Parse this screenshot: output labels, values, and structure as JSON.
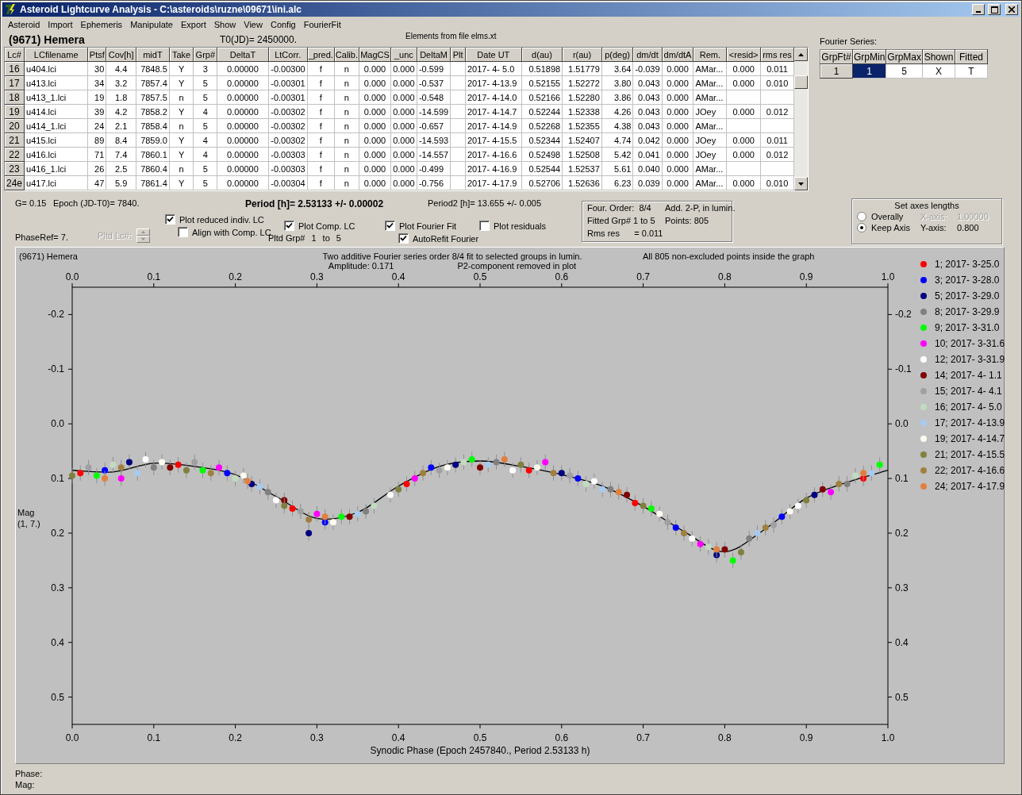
{
  "window": {
    "title": "Asteroid Lightcurve Analysis - C:\\asteroids\\ruzne\\09671\\ini.alc"
  },
  "menu": [
    "Asteroid",
    "Import",
    "Ephemeris",
    "Manipulate",
    "Export",
    "Show",
    "View",
    "Config",
    "FourierFit"
  ],
  "header": {
    "asteroid": "(9671) Hemera",
    "t0": "T0(JD)= 2450000.",
    "elements": "Elements from file elms.xt"
  },
  "table": {
    "columns": [
      "Lc#",
      "LCfilename",
      "Ptsf",
      "Cov[h]",
      "midT",
      "Take",
      "Grp#",
      "DeltaT",
      "LtCorr.",
      "_pred.",
      "Calib.",
      "MagCS",
      "_unc",
      "DeltaM",
      "Plt",
      "Date UT",
      "d(au)",
      "r(au)",
      "p(deg)",
      "dm/dt",
      "dm/dtA",
      "Rem.",
      "<resid>",
      "rms res"
    ],
    "rows": [
      [
        "16",
        "u404.lci",
        "30",
        "4.4",
        "7848.5",
        "Y",
        "3",
        "0.00000",
        "-0.00300",
        "f",
        "n",
        "0.000",
        "0.000",
        "-0.599",
        null,
        "2017- 4- 5.0",
        "0.51898",
        "1.51779",
        "3.64",
        "-0.039",
        "0.000",
        "AMar...",
        "0.000",
        "0.011"
      ],
      [
        "17",
        "u413.lci",
        "34",
        "3.2",
        "7857.4",
        "Y",
        "5",
        "0.00000",
        "-0.00301",
        "f",
        "n",
        "0.000",
        "0.000",
        "-0.537",
        null,
        "2017- 4-13.9",
        "0.52155",
        "1.52272",
        "3.80",
        "0.043",
        "0.000",
        "AMar...",
        "0.000",
        "0.010"
      ],
      [
        "18",
        "u413_1.lci",
        "19",
        "1.8",
        "7857.5",
        "n",
        "5",
        "0.00000",
        "-0.00301",
        "f",
        "n",
        "0.000",
        "0.000",
        "-0.548",
        null,
        "2017- 4-14.0",
        "0.52166",
        "1.52280",
        "3.86",
        "0.043",
        "0.000",
        "AMar...",
        null,
        null
      ],
      [
        "19",
        "u414.lci",
        "39",
        "4.2",
        "7858.2",
        "Y",
        "4",
        "0.00000",
        "-0.00302",
        "f",
        "n",
        "0.000",
        "0.000",
        "-14.599",
        null,
        "2017- 4-14.7",
        "0.52244",
        "1.52338",
        "4.26",
        "0.043",
        "0.000",
        "JOey",
        "0.000",
        "0.012"
      ],
      [
        "20",
        "u414_1.lci",
        "24",
        "2.1",
        "7858.4",
        "n",
        "5",
        "0.00000",
        "-0.00302",
        "f",
        "n",
        "0.000",
        "0.000",
        "-0.657",
        null,
        "2017- 4-14.9",
        "0.52268",
        "1.52355",
        "4.38",
        "0.043",
        "0.000",
        "AMar...",
        null,
        null
      ],
      [
        "21",
        "u415.lci",
        "89",
        "8.4",
        "7859.0",
        "Y",
        "4",
        "0.00000",
        "-0.00302",
        "f",
        "n",
        "0.000",
        "0.000",
        "-14.593",
        null,
        "2017- 4-15.5",
        "0.52344",
        "1.52407",
        "4.74",
        "0.042",
        "0.000",
        "JOey",
        "0.000",
        "0.011"
      ],
      [
        "22",
        "u416.lci",
        "71",
        "7.4",
        "7860.1",
        "Y",
        "4",
        "0.00000",
        "-0.00303",
        "f",
        "n",
        "0.000",
        "0.000",
        "-14.557",
        null,
        "2017- 4-16.6",
        "0.52498",
        "1.52508",
        "5.42",
        "0.041",
        "0.000",
        "JOey",
        "0.000",
        "0.012"
      ],
      [
        "23",
        "u416_1.lci",
        "26",
        "2.5",
        "7860.4",
        "n",
        "5",
        "0.00000",
        "-0.00303",
        "f",
        "n",
        "0.000",
        "0.000",
        "-0.499",
        null,
        "2017- 4-16.9",
        "0.52544",
        "1.52537",
        "5.61",
        "0.040",
        "0.000",
        "AMar...",
        null,
        null
      ],
      [
        "24e",
        "u417.lci",
        "47",
        "5.9",
        "7861.4",
        "Y",
        "5",
        "0.00000",
        "-0.00304",
        "f",
        "n",
        "0.000",
        "0.000",
        "-0.756",
        null,
        "2017- 4-17.9",
        "0.52706",
        "1.52636",
        "6.23",
        "0.039",
        "0.000",
        "AMar...",
        "0.000",
        "0.010"
      ]
    ]
  },
  "fourier_series": {
    "label": "Fourier Series:",
    "columns": [
      "GrpFt#",
      "GrpMin",
      "GrpMax",
      "Shown",
      "Fitted"
    ],
    "rows": [
      {
        "cells": [
          {
            "text": "1",
            "selected": false
          },
          {
            "text": "1",
            "selected": true
          },
          {
            "text": "5",
            "selected": false
          },
          {
            "text": "X",
            "selected": false
          },
          {
            "text": "T",
            "selected": false
          }
        ]
      }
    ]
  },
  "params": {
    "g": "G= 0.15",
    "epoch": "Epoch (JD-T0)= 7840.",
    "period": "Period [h]= 2.53133 +/- 0.00002",
    "period2": "Period2 [h]= 13.655 +/- 0.005",
    "phase_ref": "PhaseRef= 7.",
    "pltd_lc": {
      "label": "Pltd Lc#:",
      "disabled": true
    }
  },
  "checkboxes": [
    {
      "label": "Plot reduced indiv. LC",
      "checked": true
    },
    {
      "label": "Align with Comp. LC",
      "checked": false
    },
    {
      "label": "Plot Comp. LC",
      "checked": true
    },
    {
      "label": "Plot Fourier Fit",
      "checked": true
    },
    {
      "label": "AutoRefit Fourier",
      "checked": true
    },
    {
      "label": "Plot residuals",
      "checked": false
    }
  ],
  "pltd_grp": [
    "Pltd Grp#",
    "1",
    "to",
    "5"
  ],
  "fit_info": [
    "Four. Order:  8/4",
    "Add. 2-P, in lumin.",
    "Fitted Grp# 1 to 5",
    "Points: 805",
    "Rms res      = 0.011"
  ],
  "axes": {
    "title": "Set axes lengths",
    "rows": [
      {
        "option": "Overally",
        "selected": false,
        "axis": "X-axis:",
        "value": "1.00000",
        "disabled": true
      },
      {
        "option": "Keep Axis",
        "selected": true,
        "axis": "Y-axis:",
        "value": "0.800",
        "disabled": false
      }
    ]
  },
  "plot": {
    "name": "(9671) Hemera",
    "title": "Two additive Fourier series order 8/4 fit to selected groups in lumin.",
    "amplitude": "Amplitude: 0.171",
    "note": "P2-component removed in plot",
    "points_note": "All 805 non-excluded points inside the graph",
    "ylabel_sub": "(1, 7.)",
    "chart_data": {
      "type": "scatter",
      "xlabel": "Synodic Phase (Epoch 2457840., Period 2.53133 h)",
      "ylabel": "Mag",
      "xlim": [
        0,
        1
      ],
      "ylim": [
        0.55,
        -0.25
      ],
      "xticks": [
        {
          "value": 0,
          "label": "0.0"
        },
        {
          "value": 0.1,
          "label": "0.1"
        },
        {
          "value": 0.2,
          "label": "0.2"
        },
        {
          "value": 0.3,
          "label": "0.3"
        },
        {
          "value": 0.4,
          "label": "0.4"
        },
        {
          "value": 0.5,
          "label": "0.5"
        },
        {
          "value": 0.6,
          "label": "0.6"
        },
        {
          "value": 0.7,
          "label": "0.7"
        },
        {
          "value": 0.8,
          "label": "0.8"
        },
        {
          "value": 0.9,
          "label": "0.9"
        },
        {
          "value": 1,
          "label": "1.0"
        }
      ],
      "yticks": [
        {
          "value": -0.2,
          "label": "-0.2"
        },
        {
          "value": -0.1,
          "label": "-0.1"
        },
        {
          "value": 0,
          "label": "0.0"
        },
        {
          "value": 0.1,
          "label": "0.1"
        },
        {
          "value": 0.2,
          "label": "0.2"
        },
        {
          "value": 0.3,
          "label": "0.3"
        },
        {
          "value": 0.4,
          "label": "0.4"
        },
        {
          "value": 0.5,
          "label": "0.5"
        }
      ],
      "x": [
        0,
        0.05,
        0.1,
        0.15,
        0.2,
        0.25,
        0.3,
        0.35,
        0.4,
        0.45,
        0.5,
        0.55,
        0.6,
        0.65,
        0.7,
        0.75,
        0.8,
        0.85,
        0.9,
        0.95,
        1
      ],
      "series": [
        {
          "type": "line",
          "color": "#000000",
          "values": [
            0.085,
            0.088,
            0.072,
            0.078,
            0.093,
            0.133,
            0.173,
            0.162,
            0.114,
            0.078,
            0.068,
            0.078,
            0.093,
            0.114,
            0.151,
            0.197,
            0.234,
            0.192,
            0.136,
            0.107,
            0.085
          ]
        },
        {
          "type": "scatter",
          "name": "1; 2017- 3-25.0",
          "color": "#ff0000",
          "x": [
            0.01,
            0.13,
            0.27,
            0.41,
            0.56,
            0.69,
            0.97
          ],
          "values": [
            0.09,
            0.075,
            0.155,
            0.11,
            0.085,
            0.145,
            0.1
          ]
        },
        {
          "type": "scatter",
          "name": "3; 2017- 3-28.0",
          "color": "#0000ff",
          "x": [
            0.04,
            0.19,
            0.31,
            0.44,
            0.62,
            0.74,
            0.87
          ],
          "values": [
            0.085,
            0.09,
            0.18,
            0.08,
            0.1,
            0.19,
            0.17
          ]
        },
        {
          "type": "scatter",
          "name": "5; 2017- 3-29.0",
          "color": "#000080",
          "x": [
            0.07,
            0.22,
            0.29,
            0.47,
            0.6,
            0.79,
            0.91
          ],
          "values": [
            0.07,
            0.11,
            0.2,
            0.075,
            0.09,
            0.24,
            0.13
          ]
        },
        {
          "type": "scatter",
          "name": "8; 2017- 3-29.9",
          "color": "#808080",
          "x": [
            0.1,
            0.24,
            0.36,
            0.52,
            0.66,
            0.83,
            0.95
          ],
          "values": [
            0.08,
            0.125,
            0.16,
            0.07,
            0.12,
            0.21,
            0.11
          ]
        },
        {
          "type": "scatter",
          "name": "9; 2017- 3-31.0",
          "color": "#00ff00",
          "x": [
            0.03,
            0.16,
            0.33,
            0.49,
            0.71,
            0.81,
            0.99
          ],
          "values": [
            0.095,
            0.085,
            0.17,
            0.065,
            0.155,
            0.25,
            0.075
          ]
        },
        {
          "type": "scatter",
          "name": "10; 2017- 3-31.6",
          "color": "#ff00ff",
          "x": [
            0.06,
            0.18,
            0.3,
            0.42,
            0.58,
            0.77,
            0.93
          ],
          "values": [
            0.1,
            0.08,
            0.165,
            0.1,
            0.07,
            0.22,
            0.125
          ]
        },
        {
          "type": "scatter",
          "name": "12; 2017- 3-31.9",
          "color": "#ffffff",
          "x": [
            0.09,
            0.25,
            0.39,
            0.54,
            0.64,
            0.76,
            0.89
          ],
          "values": [
            0.065,
            0.14,
            0.13,
            0.085,
            0.105,
            0.21,
            0.15
          ]
        },
        {
          "type": "scatter",
          "name": "14; 2017- 4- 1.1",
          "color": "#800000",
          "x": [
            0.12,
            0.26,
            0.34,
            0.5,
            0.68,
            0.8,
            0.92
          ],
          "values": [
            0.08,
            0.14,
            0.17,
            0.08,
            0.13,
            0.23,
            0.12
          ]
        },
        {
          "type": "scatter",
          "name": "15; 2017- 4- 4.1",
          "color": "#a0a0a4",
          "x": [
            0.02,
            0.15,
            0.28,
            0.45,
            0.61,
            0.73,
            0.86
          ],
          "values": [
            0.08,
            0.07,
            0.16,
            0.085,
            0.095,
            0.18,
            0.185
          ]
        },
        {
          "type": "scatter",
          "name": "16; 2017- 4- 5.0",
          "color": "#c0dcc0",
          "x": [
            0.05,
            0.2,
            0.37,
            0.48,
            0.63,
            0.78,
            0.96
          ],
          "values": [
            0.075,
            0.1,
            0.15,
            0.07,
            0.11,
            0.225,
            0.095
          ]
        },
        {
          "type": "scatter",
          "name": "17; 2017- 4-13.9",
          "color": "#a6caf0",
          "x": [
            0.08,
            0.23,
            0.35,
            0.51,
            0.65,
            0.84,
            0.98
          ],
          "values": [
            0.09,
            0.115,
            0.165,
            0.075,
            0.12,
            0.2,
            0.09
          ]
        },
        {
          "type": "scatter",
          "name": "19; 2017- 4-14.7",
          "color": "#fffbf0",
          "x": [
            0.11,
            0.21,
            0.32,
            0.46,
            0.57,
            0.72,
            0.88
          ],
          "values": [
            0.07,
            0.095,
            0.18,
            0.08,
            0.08,
            0.165,
            0.16
          ]
        },
        {
          "type": "scatter",
          "name": "21; 2017- 4-15.5",
          "color": "#808040",
          "x": [
            0,
            0.14,
            0.26,
            0.4,
            0.55,
            0.7,
            0.82,
            0.9
          ],
          "values": [
            0.095,
            0.085,
            0.15,
            0.12,
            0.075,
            0.15,
            0.235,
            0.14
          ]
        },
        {
          "type": "scatter",
          "name": "22; 2017- 4-16.6",
          "color": "#a08040",
          "x": [
            0.06,
            0.17,
            0.29,
            0.43,
            0.59,
            0.75,
            0.85,
            0.94
          ],
          "values": [
            0.08,
            0.09,
            0.175,
            0.09,
            0.09,
            0.2,
            0.19,
            0.11
          ]
        },
        {
          "type": "scatter",
          "name": "24; 2017- 4-17.9",
          "color": "#e08040",
          "x": [
            0.04,
            0.215,
            0.31,
            0.53,
            0.67,
            0.79,
            0.97
          ],
          "values": [
            0.1,
            0.105,
            0.17,
            0.065,
            0.125,
            0.23,
            0.09
          ]
        }
      ]
    }
  },
  "status": [
    "Phase:",
    "Mag:"
  ]
}
